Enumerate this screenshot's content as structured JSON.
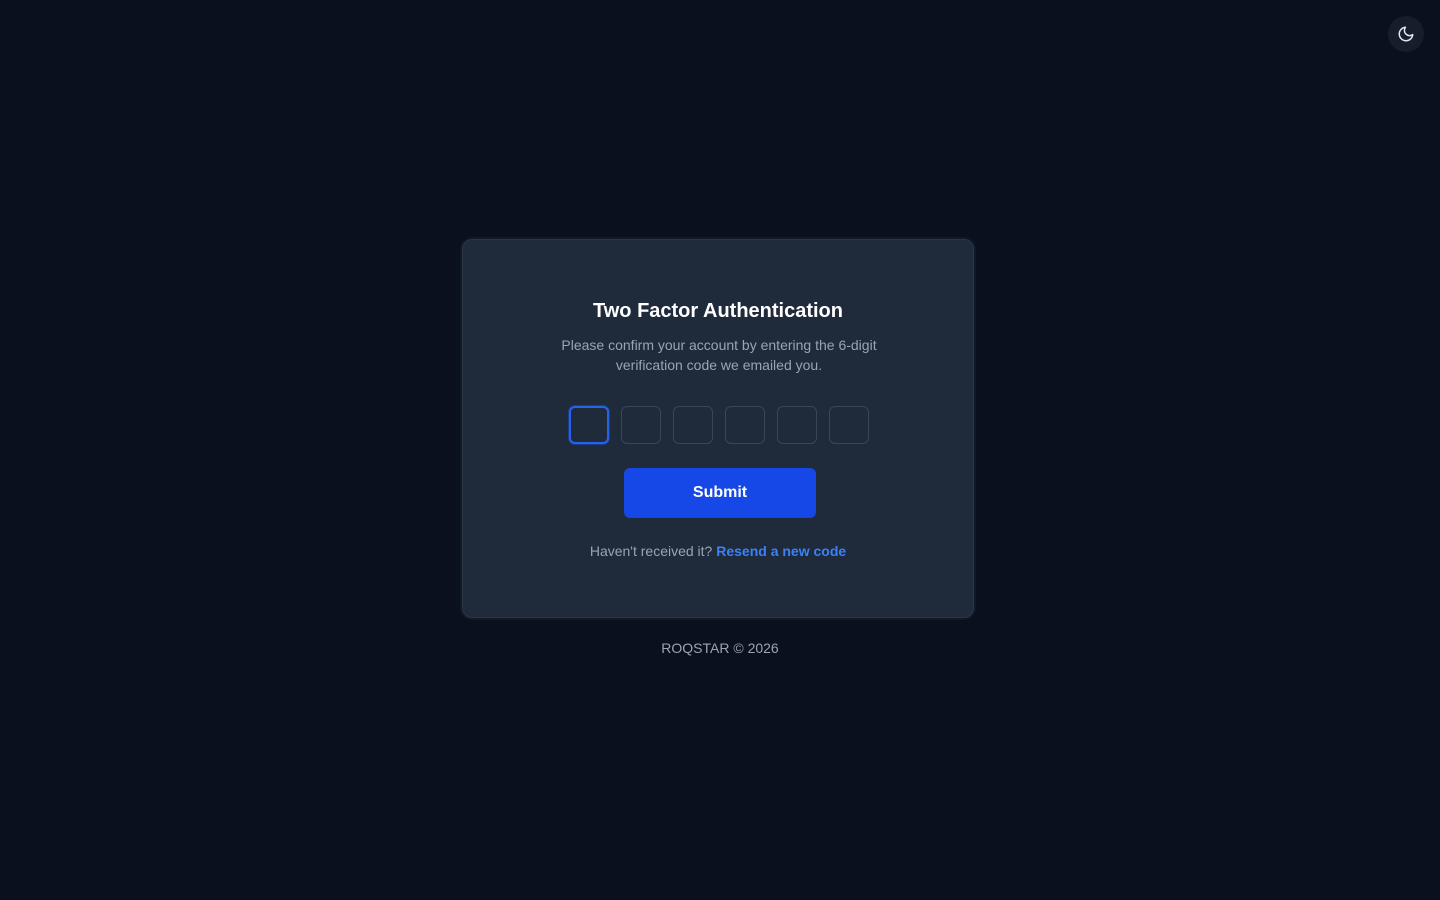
{
  "theme_toggle": {
    "icon": "moon-icon"
  },
  "auth": {
    "title": "Two Factor Authentication",
    "description": "Please confirm your account by entering the 6-digit verification code we emailed you.",
    "code_digits": [
      "",
      "",
      "",
      "",
      "",
      ""
    ],
    "submit_label": "Submit",
    "resend_prompt": "Haven't received it?",
    "resend_link": "Resend a new code"
  },
  "footer": {
    "text": "ROQSTAR © 2026"
  },
  "colors": {
    "background": "#0a101e",
    "card": "#1f2a3b",
    "accent": "#1548e6",
    "link": "#3b82f6"
  }
}
